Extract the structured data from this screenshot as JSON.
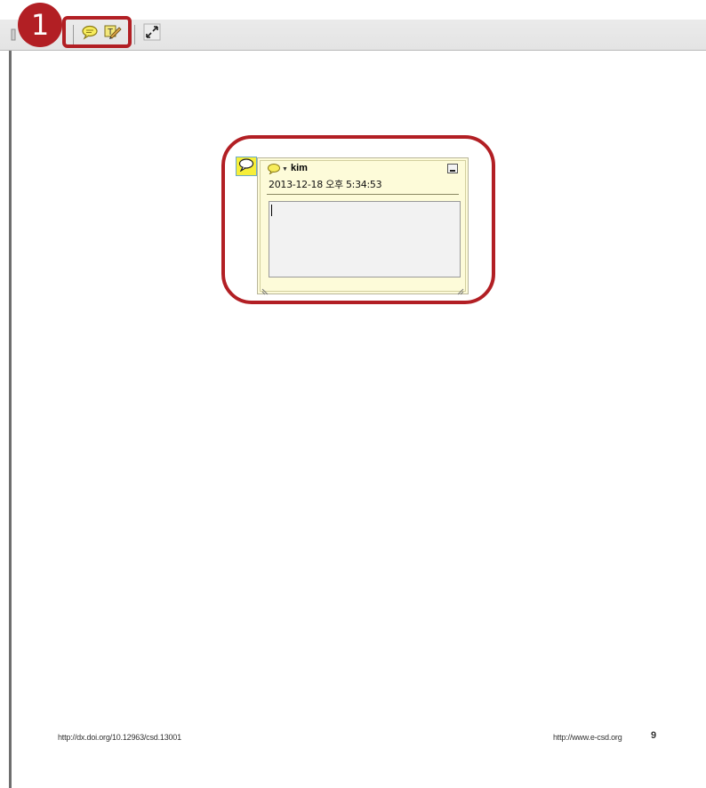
{
  "toolbar": {
    "tools": [
      {
        "name": "sticky-note-tool",
        "icon": "speech-bubble-icon"
      },
      {
        "name": "text-markup-tool",
        "icon": "text-edit-pencil-icon"
      },
      {
        "name": "expand-tool",
        "icon": "expand-arrows-icon"
      }
    ]
  },
  "callout": {
    "badge_number": "1",
    "color": "#b21f24"
  },
  "note": {
    "author": "kim",
    "date": "2013-12-18 오후 5:34:53",
    "text": "",
    "background_color": "#fdfbd9",
    "marker_color": "#f6ee3a"
  },
  "footer": {
    "doi": "http://dx.doi.org/10.12963/csd.13001",
    "site": "http://www.e-csd.org",
    "page_number": "9"
  }
}
